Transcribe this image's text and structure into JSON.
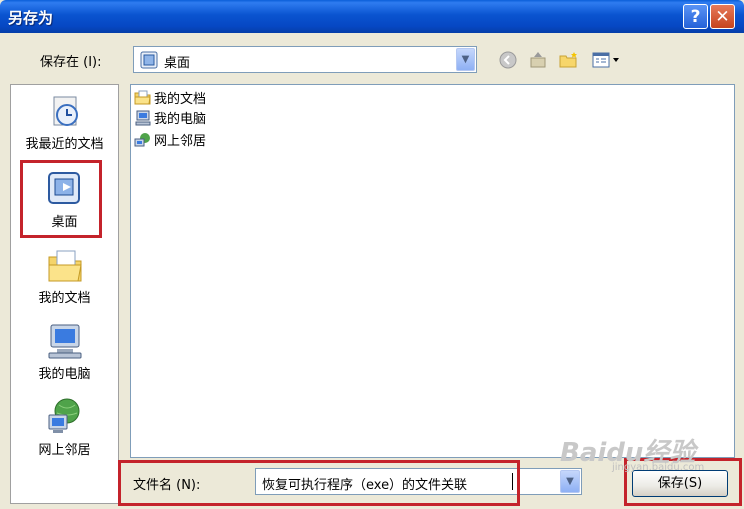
{
  "window": {
    "title": "另存为"
  },
  "save_in": {
    "label": "保存在 (I):",
    "value": "桌面"
  },
  "places": [
    {
      "name": "recent",
      "label": "我最近的文档",
      "icon": "recent-documents-icon"
    },
    {
      "name": "desktop",
      "label": "桌面",
      "icon": "desktop-icon"
    },
    {
      "name": "my-documents",
      "label": "我的文档",
      "icon": "my-documents-icon"
    },
    {
      "name": "my-computer",
      "label": "我的电脑",
      "icon": "my-computer-icon"
    },
    {
      "name": "network",
      "label": "网上邻居",
      "icon": "network-places-icon"
    }
  ],
  "files": [
    {
      "label": "我的文档",
      "icon": "folder-icon"
    },
    {
      "label": "我的电脑",
      "icon": "computer-icon"
    },
    {
      "label": "网上邻居",
      "icon": "network-icon"
    }
  ],
  "filename": {
    "label": "文件名 (N):",
    "value": "恢复可执行程序（exe）的文件关联"
  },
  "buttons": {
    "save": "保存(S)"
  },
  "watermark": {
    "brand": "Baidu经验",
    "url": "jingyan.baidu.com"
  },
  "colors": {
    "title_bar": "#0a54d0",
    "highlight": "#c4232b"
  }
}
